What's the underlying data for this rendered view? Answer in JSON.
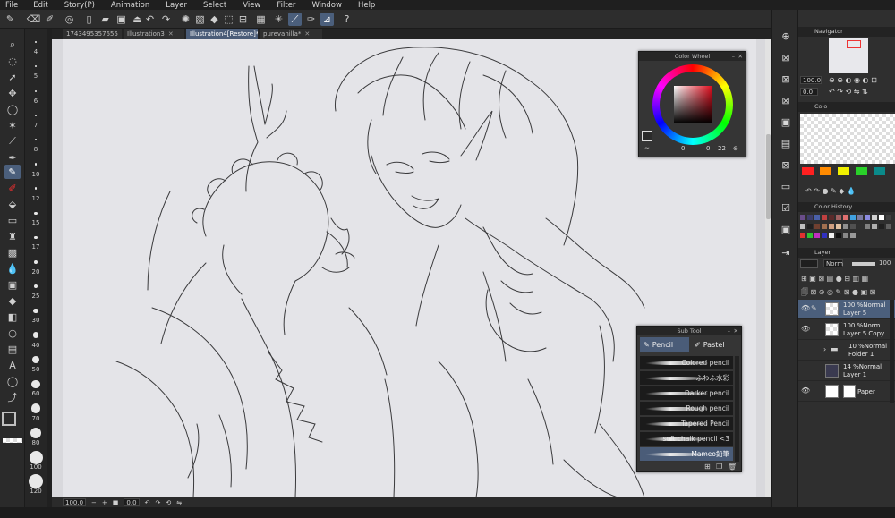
{
  "menu": [
    "File",
    "Edit",
    "Story(P)",
    "Animation",
    "Layer",
    "Select",
    "View",
    "Filter",
    "Window",
    "Help"
  ],
  "tabs": [
    {
      "label": "1743495357655",
      "active": false
    },
    {
      "label": "Illustration3",
      "active": false
    },
    {
      "label": "Illustration4[Restore]*",
      "active": true
    },
    {
      "label": "purevanilla*",
      "active": false
    }
  ],
  "size_labels": [
    "4",
    "5",
    "6",
    "7",
    "8",
    "10",
    "12",
    "15",
    "17",
    "20",
    "25",
    "30",
    "40",
    "50",
    "60",
    "70",
    "80",
    "100",
    "120"
  ],
  "status": {
    "zoom": "100.0",
    "angle": "0.0"
  },
  "color_wheel": {
    "title": "Color Wheel",
    "values": [
      "0",
      "0",
      "22"
    ],
    "selected_color": "#e01020"
  },
  "sub_tool": {
    "title": "Sub Tool",
    "tabs": [
      "Pencil",
      "Pastel"
    ],
    "items": [
      "Colored pencil",
      "ふわふ水彩",
      "Darker pencil",
      "Rough pencil",
      "Tapered Pencil",
      "soft chalk pencil <3",
      "Mameo鉛筆"
    ],
    "active_index": 6
  },
  "navigator": {
    "title": "Navigator",
    "zoom": "100.0",
    "angle": "0.0"
  },
  "color_set": {
    "title": "Colo",
    "swatches": [
      "#ff2020",
      "#ff8a00",
      "#f0f000",
      "#2ad12a",
      "#0a8a8a"
    ]
  },
  "color_history": {
    "title": "Color History"
  },
  "layer_panel": {
    "title": "Layer",
    "blend_mode": "Norm",
    "opacity": "100",
    "layers": [
      {
        "pct": "100 %Normal",
        "name": "Layer 5",
        "active": true
      },
      {
        "pct": "100 %Norm",
        "name": "Layer 5 Copy",
        "active": false
      },
      {
        "pct": "10 %Normal",
        "name": "Folder 1",
        "active": false
      },
      {
        "pct": "14 %Normal",
        "name": "Layer 1",
        "active": false
      },
      {
        "pct": "",
        "name": "Paper",
        "active": false
      }
    ]
  }
}
